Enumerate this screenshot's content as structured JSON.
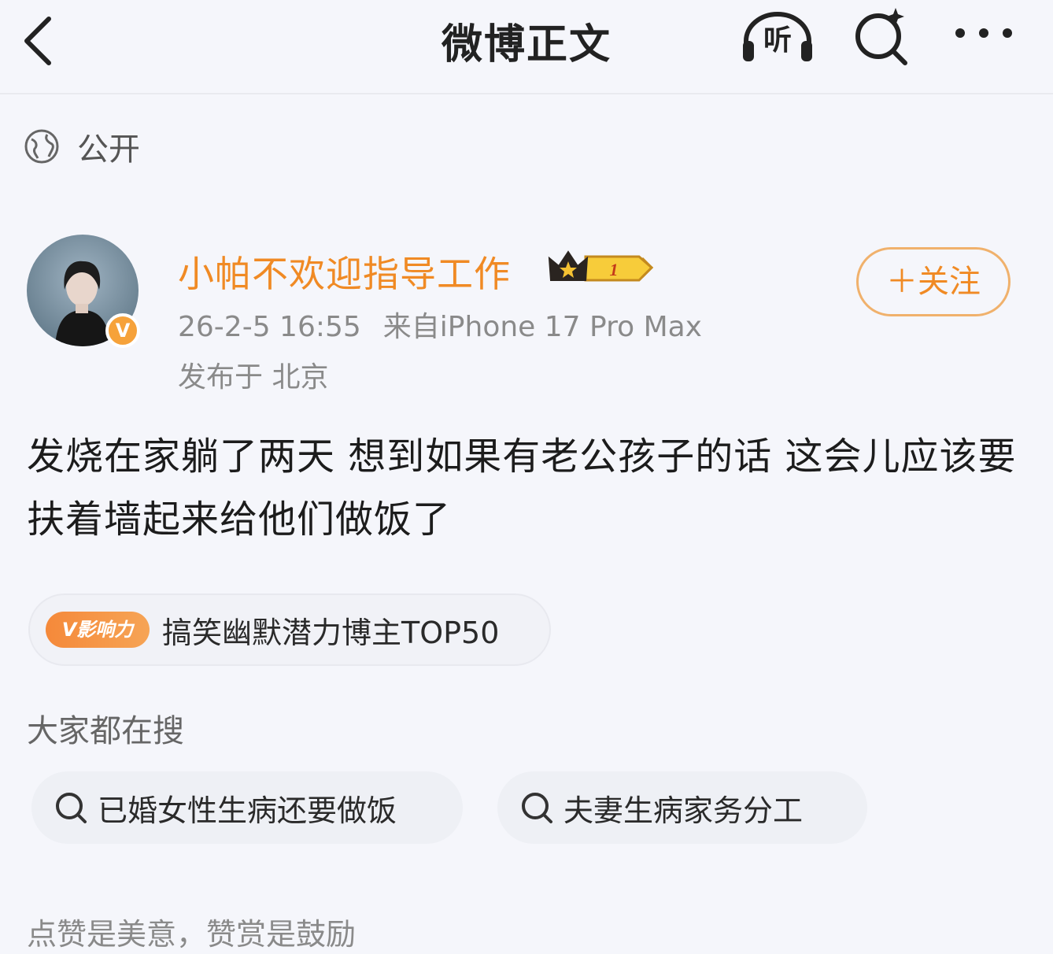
{
  "header": {
    "title": "微博正文",
    "listen_label": "听",
    "back_icon": "chevron-left-icon",
    "listen_icon": "headphones-icon",
    "search_icon": "search-sparkle-icon",
    "more_icon": "more-dots-icon"
  },
  "visibility": {
    "icon": "globe-icon",
    "label": "公开"
  },
  "author": {
    "name": "小帕不欢迎指导工作",
    "verified_mark": "V",
    "badge_icon": "crown-level-badge-icon",
    "badge_level": "1",
    "meta": {
      "time": "26-2-5 16:55",
      "source": "来自iPhone 17 Pro Max"
    },
    "location": "发布于 北京",
    "follow_label": "＋关注"
  },
  "post": {
    "text": "发烧在家躺了两天 想到如果有老公孩子的话 这会儿应该要扶着墙起来给他们做饭了"
  },
  "influence": {
    "pill": "V影响力",
    "label": "搞笑幽默潜力博主TOP50"
  },
  "search_section": {
    "title": "大家都在搜",
    "items": [
      {
        "label": "已婚女性生病还要做饭"
      },
      {
        "label": "夫妻生病家务分工"
      }
    ]
  },
  "footer": {
    "tip": "点赞是美意，赞赏是鼓励"
  },
  "colors": {
    "accent_orange": "#f08a24",
    "background": "#f5f6fb",
    "muted_text": "#8a8a8a"
  }
}
